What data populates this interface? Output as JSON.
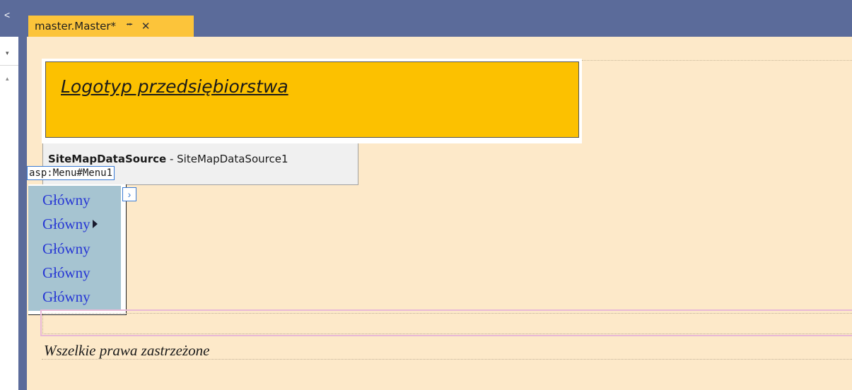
{
  "tab": {
    "label": "master.Master*",
    "pin": "⭺",
    "close": "✕"
  },
  "gutter": {
    "arrow": "<",
    "drop": "▾",
    "up": "▴"
  },
  "header": {
    "logo_text": "Logotyp przedsiębiorstwa"
  },
  "sitemap": {
    "type_label": "SiteMapDataSource",
    "separator": " - ",
    "instance_label": "SiteMapDataSource1"
  },
  "menu": {
    "tag_label": "asp:Menu#Menu1",
    "smart_tag": "›",
    "items": [
      {
        "label": "Główny",
        "has_submenu": false
      },
      {
        "label": "Główny",
        "has_submenu": true
      },
      {
        "label": "Główny",
        "has_submenu": false
      },
      {
        "label": "Główny",
        "has_submenu": false
      },
      {
        "label": "Główny",
        "has_submenu": false
      }
    ]
  },
  "footer": {
    "text": "Wszelkie prawa zastrzeżone"
  },
  "colors": {
    "designer_bg": "#fde9c9",
    "tab_active": "#fcc43a",
    "logo_bg": "#fcc100",
    "menu_bg": "#a6c4d1",
    "menu_link": "#2636d4",
    "frame": "#5b6b9a"
  }
}
